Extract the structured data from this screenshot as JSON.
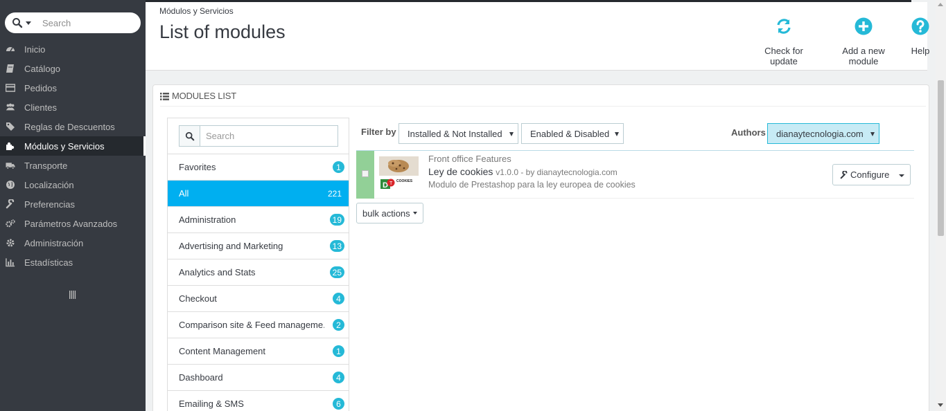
{
  "sidebar": {
    "search_placeholder": "Search",
    "items": [
      {
        "label": "Inicio",
        "icon": "dashboard-icon"
      },
      {
        "label": "Catálogo",
        "icon": "book-icon"
      },
      {
        "label": "Pedidos",
        "icon": "credit-card-icon"
      },
      {
        "label": "Clientes",
        "icon": "users-icon"
      },
      {
        "label": "Reglas de Descuentos",
        "icon": "tags-icon"
      },
      {
        "label": "Módulos y Servicios",
        "icon": "puzzle-icon",
        "active": true
      },
      {
        "label": "Transporte",
        "icon": "truck-icon"
      },
      {
        "label": "Localización",
        "icon": "globe-icon"
      },
      {
        "label": "Preferencias",
        "icon": "wrench-icon"
      },
      {
        "label": "Parámetros Avanzados",
        "icon": "cogs-icon"
      },
      {
        "label": "Administración",
        "icon": "gear-icon"
      },
      {
        "label": "Estadísticas",
        "icon": "bar-chart-icon"
      }
    ]
  },
  "header": {
    "breadcrumb": "Módulos y Servicios",
    "title": "List of modules",
    "toolbar": {
      "check_update": "Check for update",
      "add_module": "Add a new module",
      "help": "Help"
    }
  },
  "panel": {
    "heading": "Modules list",
    "category_search_placeholder": "Search",
    "categories": [
      {
        "name": "Favorites",
        "count": "1"
      },
      {
        "name": "All",
        "count": "221",
        "active": true
      },
      {
        "name": "Administration",
        "count": "19"
      },
      {
        "name": "Advertising and Marketing",
        "count": "13"
      },
      {
        "name": "Analytics and Stats",
        "count": "25"
      },
      {
        "name": "Checkout",
        "count": "4"
      },
      {
        "name": "Comparison site & Feed manageme...",
        "count": "2"
      },
      {
        "name": "Content Management",
        "count": "1"
      },
      {
        "name": "Dashboard",
        "count": "4"
      },
      {
        "name": "Emailing & SMS",
        "count": "6"
      }
    ],
    "filters": {
      "filter_by_label": "Filter by",
      "install_filter": "Installed & Not Installed",
      "status_filter": "Enabled & Disabled",
      "authors_label": "Authors",
      "authors_value": "dianaytecnologia.com"
    },
    "module": {
      "category": "Front office Features",
      "name": "Ley de cookies",
      "version_author": "v1.0.0 - by dianaytecnologia.com",
      "description": "Modulo de Prestashop para la ley europea de cookies",
      "logo_text": "COOKIES",
      "configure_label": "Configure"
    },
    "bulk_actions_label": "bulk actions"
  },
  "colors": {
    "sidebar_bg": "#363a41",
    "accent": "#25b9d7",
    "active_category": "#00aff0",
    "module_status": "#92d097"
  }
}
